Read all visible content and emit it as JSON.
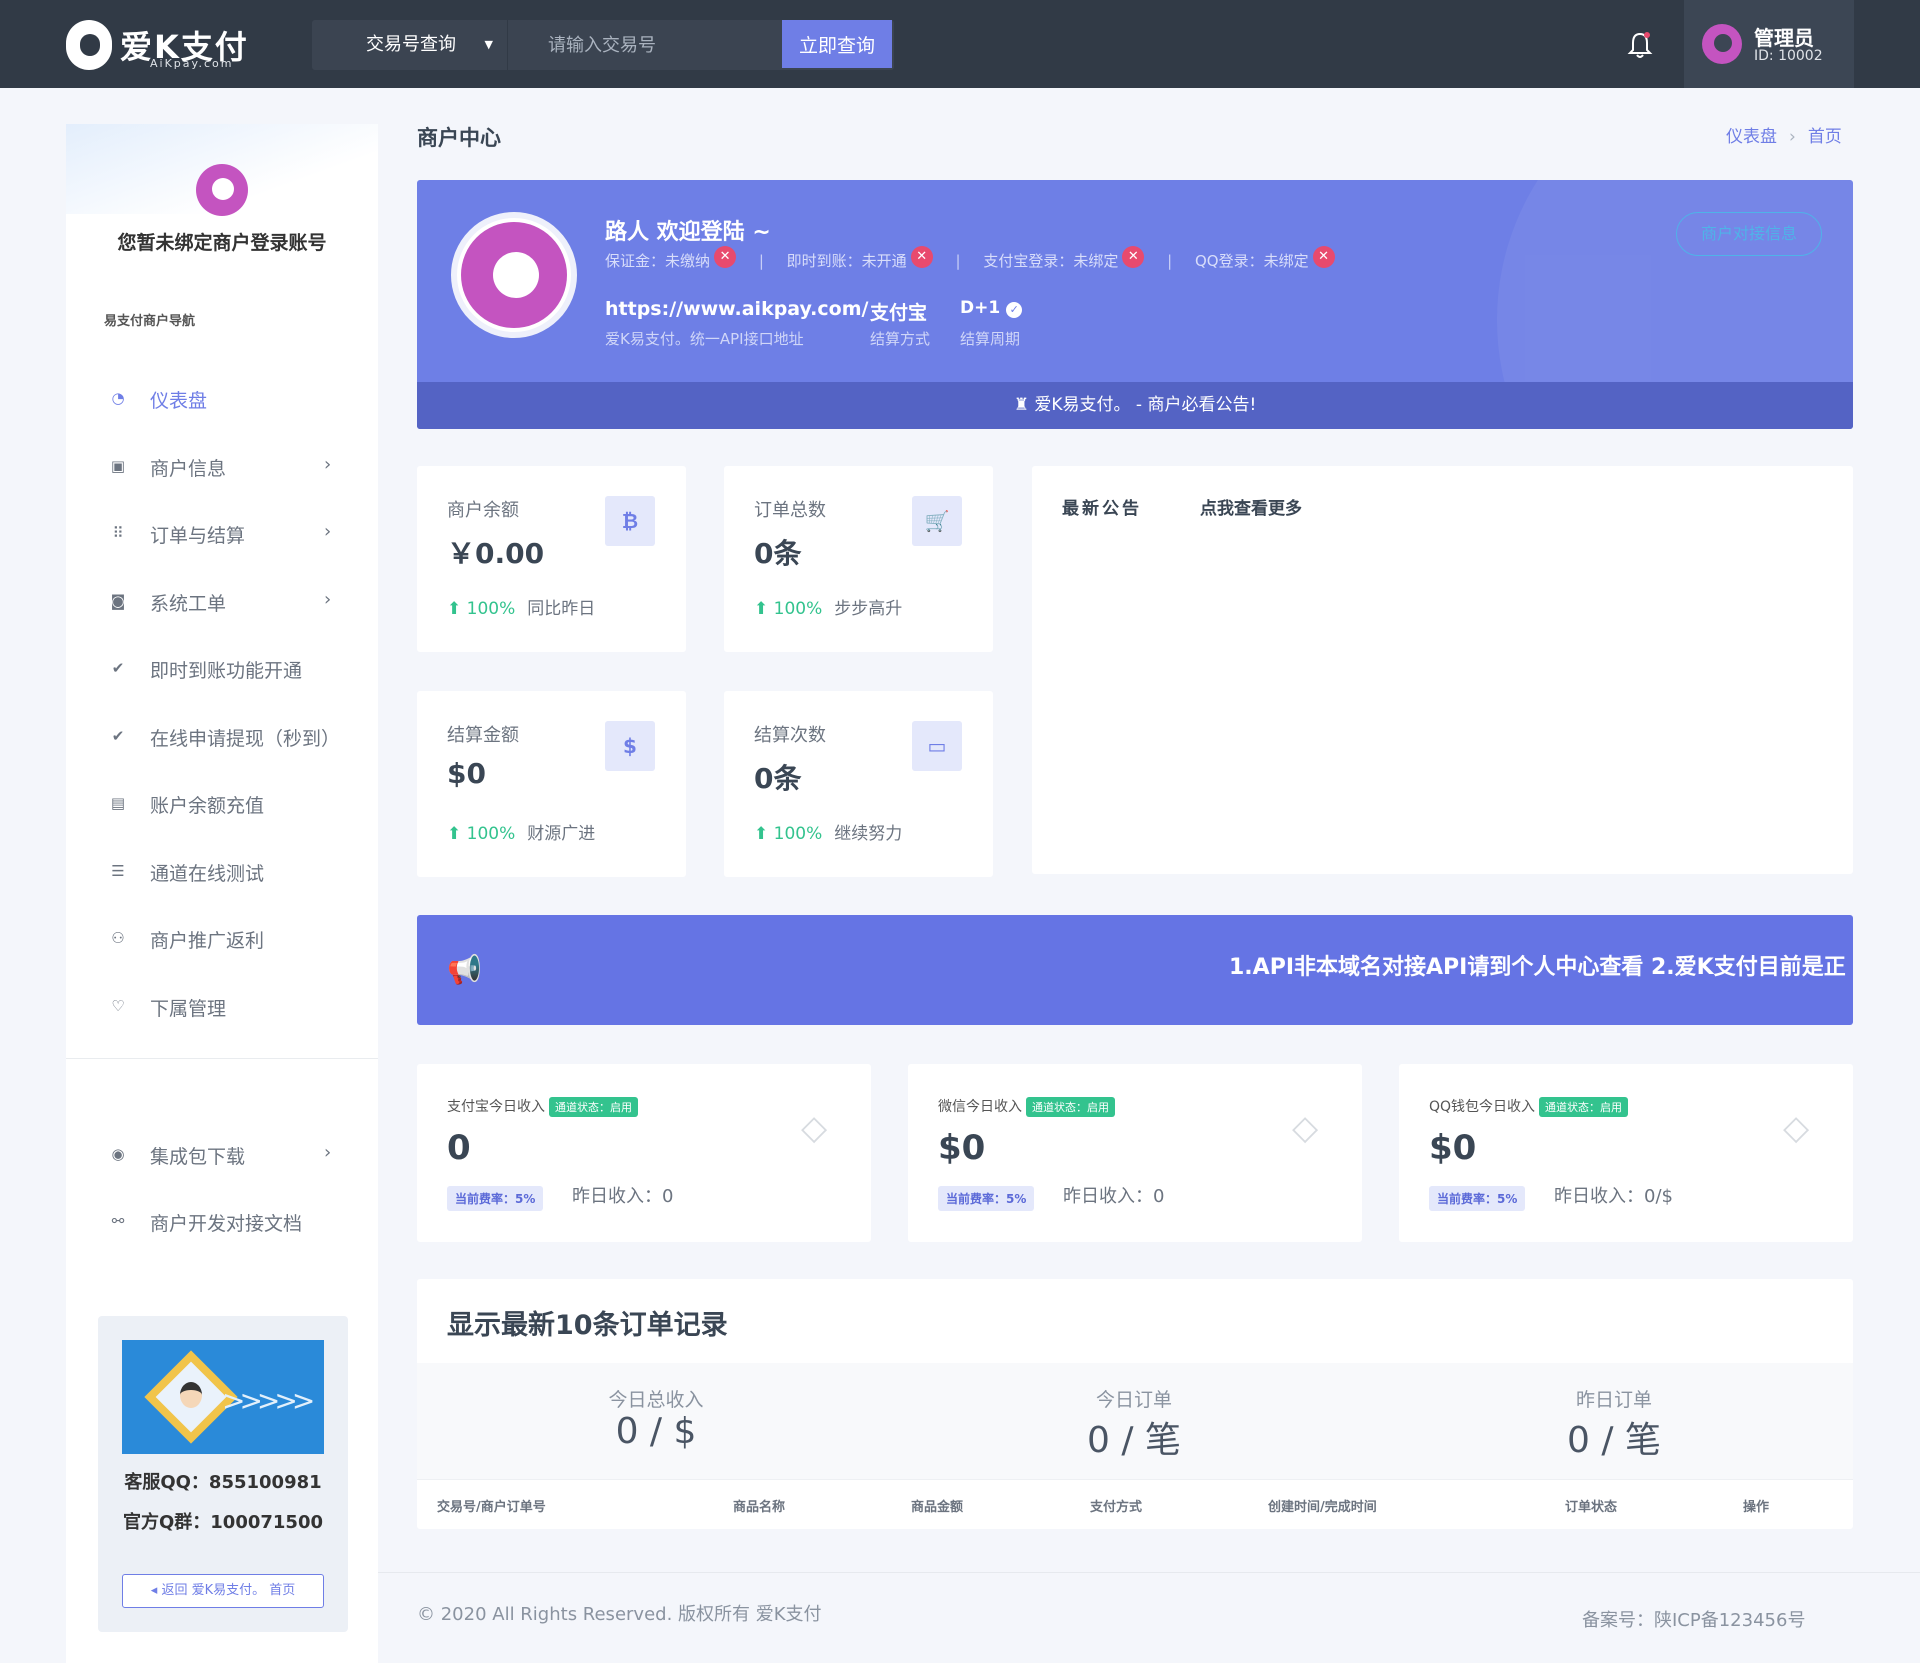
{
  "header": {
    "brand": "爱K支付",
    "brand_sub": "AiKpay.com",
    "search_type": "交易号查询",
    "search_placeholder": "请输入交易号",
    "search_button": "立即查询",
    "user_name": "管理员",
    "user_id": "ID: 10002"
  },
  "sidebar": {
    "bind_notice": "您暂未绑定商户登录账号",
    "nav_title": "易支付商户导航",
    "items": [
      {
        "label": "仪表盘",
        "icon": "dashboard-icon"
      },
      {
        "label": "商户信息",
        "icon": "id-card-icon"
      },
      {
        "label": "订单与结算",
        "icon": "grid-icon"
      },
      {
        "label": "系统工单",
        "icon": "ticket-icon"
      },
      {
        "label": "即时到账功能开通",
        "icon": "check-circle-icon"
      },
      {
        "label": "在线申请提现（秒到）",
        "icon": "check-circle-icon"
      },
      {
        "label": "账户余额充值",
        "icon": "cash-icon"
      },
      {
        "label": "通道在线测试",
        "icon": "list-icon"
      },
      {
        "label": "商户推广返利",
        "icon": "users-icon"
      },
      {
        "label": "下属管理",
        "icon": "heart-icon"
      }
    ],
    "items2": [
      {
        "label": "集成包下载",
        "icon": "circle-icon"
      },
      {
        "label": "商户开发对接文档",
        "icon": "link-icon"
      }
    ],
    "qq": "客服QQ：855100981",
    "group": "官方Q群：100071500",
    "back": "返回 爱K易支付。 首页"
  },
  "page": {
    "title": "商户中心",
    "crumb1": "仪表盘",
    "crumb2": "首页"
  },
  "hero": {
    "welcome": "路人 欢迎登陆 ~",
    "deposit_label": "保证金：",
    "deposit_value": "未缴纳",
    "instant_label": "即时到账：",
    "instant_value": "未开通",
    "alipay_label": "支付宝登录：",
    "alipay_value": "未绑定",
    "qq_label": "QQ登录：",
    "qq_value": "未绑定",
    "url": "https://www.aikpay.com/",
    "url_sub": "爱K易支付。统一API接口地址",
    "pay": "支付宝",
    "pay_sub": "结算方式",
    "cycle": "D+1",
    "cycle_sub": "结算周期",
    "button": "商户对接信息",
    "notice": "爱K易支付。 - 商户必看公告!"
  },
  "stats": [
    {
      "label": "商户余额",
      "value": "￥0.00",
      "pct": "100%",
      "note": "同比昨日",
      "icon": "bitcoin-icon",
      "glyph": "₿"
    },
    {
      "label": "订单总数",
      "value": "0条",
      "pct": "100%",
      "note": "步步高升",
      "icon": "cart-icon",
      "glyph": "🛒"
    },
    {
      "label": "结算金额",
      "value": "$0",
      "pct": "100%",
      "note": "财源广进",
      "icon": "dollar-icon",
      "glyph": "$"
    },
    {
      "label": "结算次数",
      "value": "0条",
      "pct": "100%",
      "note": "继续努力",
      "icon": "card-icon",
      "glyph": "▭"
    }
  ],
  "announce": {
    "title": "最新公告",
    "more": "点我查看更多"
  },
  "marquee": "1.API非本域名对接API请到个人中心查看 2.爱K支付目前是正",
  "channels": [
    {
      "label": "支付宝今日收入",
      "badge": "通道状态：启用",
      "value": "0",
      "rate": "当前费率：5%",
      "yest": "昨日收入：0"
    },
    {
      "label": "微信今日收入",
      "badge": "通道状态：启用",
      "value": "$0",
      "rate": "当前费率：5%",
      "yest": "昨日收入：0"
    },
    {
      "label": "QQ钱包今日收入",
      "badge": "通道状态：启用",
      "value": "$0",
      "rate": "当前费率：5%",
      "yest": "昨日收入：0/$"
    }
  ],
  "orders": {
    "title": "显示最新10条订单记录",
    "summary": [
      {
        "k": "今日总收入",
        "v": "0 / $"
      },
      {
        "k": "今日订单",
        "v": "0 / 笔"
      },
      {
        "k": "昨日订单",
        "v": "0 / 笔"
      }
    ],
    "columns": [
      "交易号/商户订单号",
      "商品名称",
      "商品金额",
      "支付方式",
      "创建时间/完成时间",
      "订单状态",
      "操作"
    ]
  },
  "footer": {
    "copyright": "© 2020 All Rights Reserved. 版权所有 爱K支付",
    "icp": "备案号：陕ICP备123456号"
  },
  "colors": {
    "accent": "#6f7ee6",
    "topbar": "#313a46",
    "success": "#33c38e",
    "danger": "#e84a6e"
  }
}
